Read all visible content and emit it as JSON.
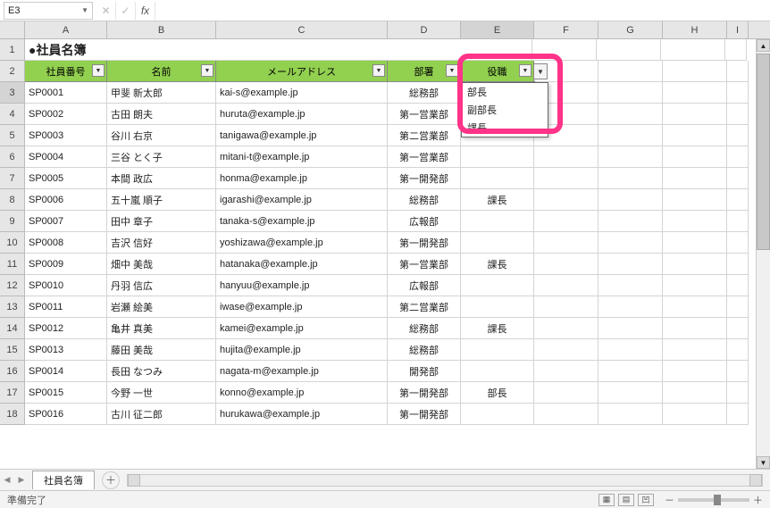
{
  "name_box": "E3",
  "formula": "",
  "columns": [
    "A",
    "B",
    "C",
    "D",
    "E",
    "F",
    "G",
    "H",
    "I"
  ],
  "selected_col": "E",
  "selected_row": 3,
  "title": "●社員名簿",
  "headers": [
    "社員番号",
    "名前",
    "メールアドレス",
    "部署",
    "役職"
  ],
  "rows": [
    {
      "id": "SP0001",
      "name": "甲斐 新太郎",
      "email": "kai-s@example.jp",
      "dept": "総務部",
      "role": ""
    },
    {
      "id": "SP0002",
      "name": "古田 朗夫",
      "email": "huruta@example.jp",
      "dept": "第一営業部",
      "role": ""
    },
    {
      "id": "SP0003",
      "name": "谷川 右京",
      "email": "tanigawa@example.jp",
      "dept": "第二営業部",
      "role": ""
    },
    {
      "id": "SP0004",
      "name": "三谷 とく子",
      "email": "mitani-t@example.jp",
      "dept": "第一営業部",
      "role": ""
    },
    {
      "id": "SP0005",
      "name": "本間 政広",
      "email": "honma@example.jp",
      "dept": "第一開発部",
      "role": ""
    },
    {
      "id": "SP0006",
      "name": "五十嵐 順子",
      "email": "igarashi@example.jp",
      "dept": "総務部",
      "role": "課長"
    },
    {
      "id": "SP0007",
      "name": "田中 章子",
      "email": "tanaka-s@example.jp",
      "dept": "広報部",
      "role": ""
    },
    {
      "id": "SP0008",
      "name": "吉沢 信好",
      "email": "yoshizawa@example.jp",
      "dept": "第一開発部",
      "role": ""
    },
    {
      "id": "SP0009",
      "name": "畑中 美哉",
      "email": "hatanaka@example.jp",
      "dept": "第一営業部",
      "role": "課長"
    },
    {
      "id": "SP0010",
      "name": "丹羽 信広",
      "email": "hanyuu@example.jp",
      "dept": "広報部",
      "role": ""
    },
    {
      "id": "SP0011",
      "name": "岩瀬 絵美",
      "email": "iwase@example.jp",
      "dept": "第二営業部",
      "role": ""
    },
    {
      "id": "SP0012",
      "name": "亀井 真美",
      "email": "kamei@example.jp",
      "dept": "総務部",
      "role": "課長"
    },
    {
      "id": "SP0013",
      "name": "藤田 美哉",
      "email": "hujita@example.jp",
      "dept": "総務部",
      "role": ""
    },
    {
      "id": "SP0014",
      "name": "長田 なつみ",
      "email": "nagata-m@example.jp",
      "dept": "開発部",
      "role": ""
    },
    {
      "id": "SP0015",
      "name": "今野 一世",
      "email": "konno@example.jp",
      "dept": "第一開発部",
      "role": "部長"
    },
    {
      "id": "SP0016",
      "name": "古川 征二郎",
      "email": "hurukawa@example.jp",
      "dept": "第一開発部",
      "role": ""
    }
  ],
  "dropdown_options": [
    "部長",
    "副部長",
    "課長"
  ],
  "sheet_tab": "社員名簿",
  "status": "準備完了",
  "zoom_minus": "－",
  "zoom_plus": "＋"
}
